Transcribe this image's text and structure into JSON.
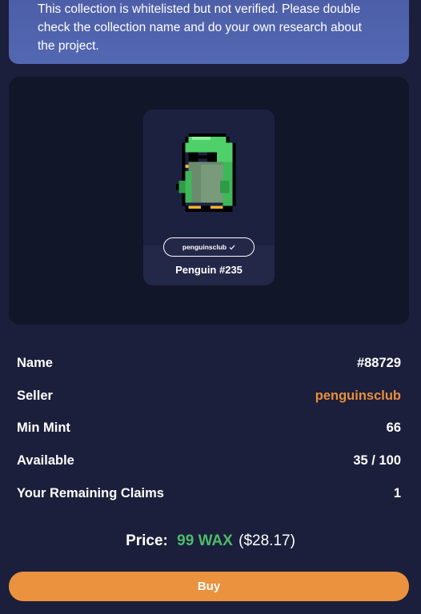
{
  "warning": {
    "text": "This collection is whitelisted but not verified. Please double check the collection name and do your own research about the project."
  },
  "card": {
    "collection": "penguinsclub",
    "verified_icon": "check-icon",
    "title": "Penguin #235",
    "art_icon": "pixel-penguin"
  },
  "details": [
    {
      "label": "Name",
      "value": "#88729"
    },
    {
      "label": "Seller",
      "value": "penguinsclub"
    },
    {
      "label": "Min Mint",
      "value": "66"
    },
    {
      "label": "Available",
      "value": "35 / 100"
    },
    {
      "label": "Your Remaining Claims",
      "value": "1"
    }
  ],
  "price": {
    "label": "Price:",
    "amount": "99 WAX",
    "usd": "($28.17)"
  },
  "buy_label": "Buy",
  "colors": {
    "background": "#1b1f3b",
    "accent": "#ea923e",
    "seller": "#ea8e3c",
    "price_green": "#4cbb6a",
    "warning_bg": "#5066b0"
  }
}
